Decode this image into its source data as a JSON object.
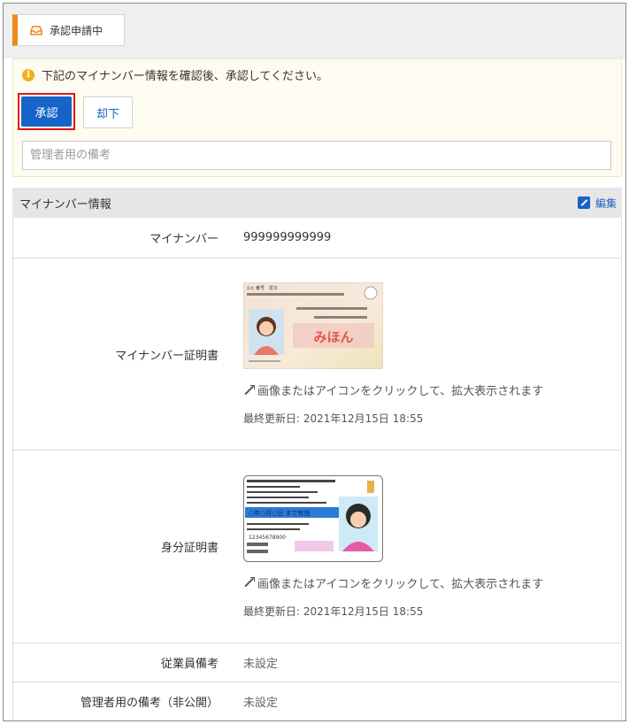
{
  "status": {
    "label": "承認申請中"
  },
  "notice": {
    "message": "下記のマイナンバー情報を確認後、承認してください。",
    "approve_label": "承認",
    "reject_label": "却下",
    "memo_placeholder": "管理者用の備考"
  },
  "section": {
    "title": "マイナンバー情報",
    "edit_label": "編集"
  },
  "rows": {
    "mynumber": {
      "label": "マイナンバー",
      "value": "999999999999"
    },
    "mynumber_cert": {
      "label": "マイナンバー証明書",
      "card_name_caption": "氏名",
      "card_name": "番号　花子",
      "card_stamp": "みほん",
      "hint": "画像またはアイコンをクリックして、拡大表示されます",
      "updated": "最終更新日: 2021年12月15日 18:55"
    },
    "id_cert": {
      "label": "身分証明書",
      "card_line": "○年○月○日 まで有効",
      "card_number": "12345678900",
      "hint": "画像またはアイコンをクリックして、拡大表示されます",
      "updated": "最終更新日: 2021年12月15日 18:55"
    },
    "employee_memo": {
      "label": "従業員備考",
      "value": "未設定"
    },
    "admin_memo": {
      "label": "管理者用の備考（非公開）",
      "value": "未設定"
    }
  },
  "colors": {
    "accent": "#ed8a1c",
    "primary": "#1564c8",
    "highlight": "#e01414",
    "link": "#1a63c4"
  }
}
